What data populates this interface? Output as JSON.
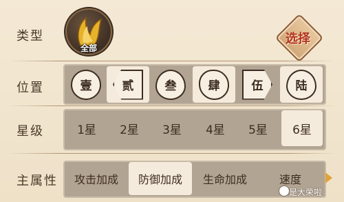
{
  "labels": {
    "type": "类型",
    "position": "位置",
    "star": "星级",
    "attribute": "主属性"
  },
  "type_filter": {
    "selected_text": "全部",
    "icon": "golden-wings-icon"
  },
  "select_button": {
    "label": "选择"
  },
  "positions": [
    {
      "label": "壹",
      "shape": "circle",
      "selected": false
    },
    {
      "label": "贰",
      "shape": "point-left",
      "selected": true
    },
    {
      "label": "叁",
      "shape": "drop",
      "selected": false
    },
    {
      "label": "肆",
      "shape": "blob",
      "selected": true
    },
    {
      "label": "伍",
      "shape": "point-right",
      "selected": false
    },
    {
      "label": "陆",
      "shape": "drop",
      "selected": true
    }
  ],
  "stars": [
    {
      "label": "1星",
      "selected": false
    },
    {
      "label": "2星",
      "selected": false
    },
    {
      "label": "3星",
      "selected": false
    },
    {
      "label": "4星",
      "selected": false
    },
    {
      "label": "5星",
      "selected": false
    },
    {
      "label": "6星",
      "selected": true
    }
  ],
  "attributes": [
    {
      "label": "攻击加成",
      "selected": false
    },
    {
      "label": "防御加成",
      "selected": true
    },
    {
      "label": "生命加成",
      "selected": false
    },
    {
      "label": "速度",
      "selected": false
    }
  ],
  "watermark": "是大荣啦",
  "colors": {
    "panel_bg": "#f2e6d0",
    "bar_bg": "#b2a492",
    "selected_bg": "#f5ebdc",
    "select_text": "#b2331f",
    "arrow": "#e0a43a"
  }
}
